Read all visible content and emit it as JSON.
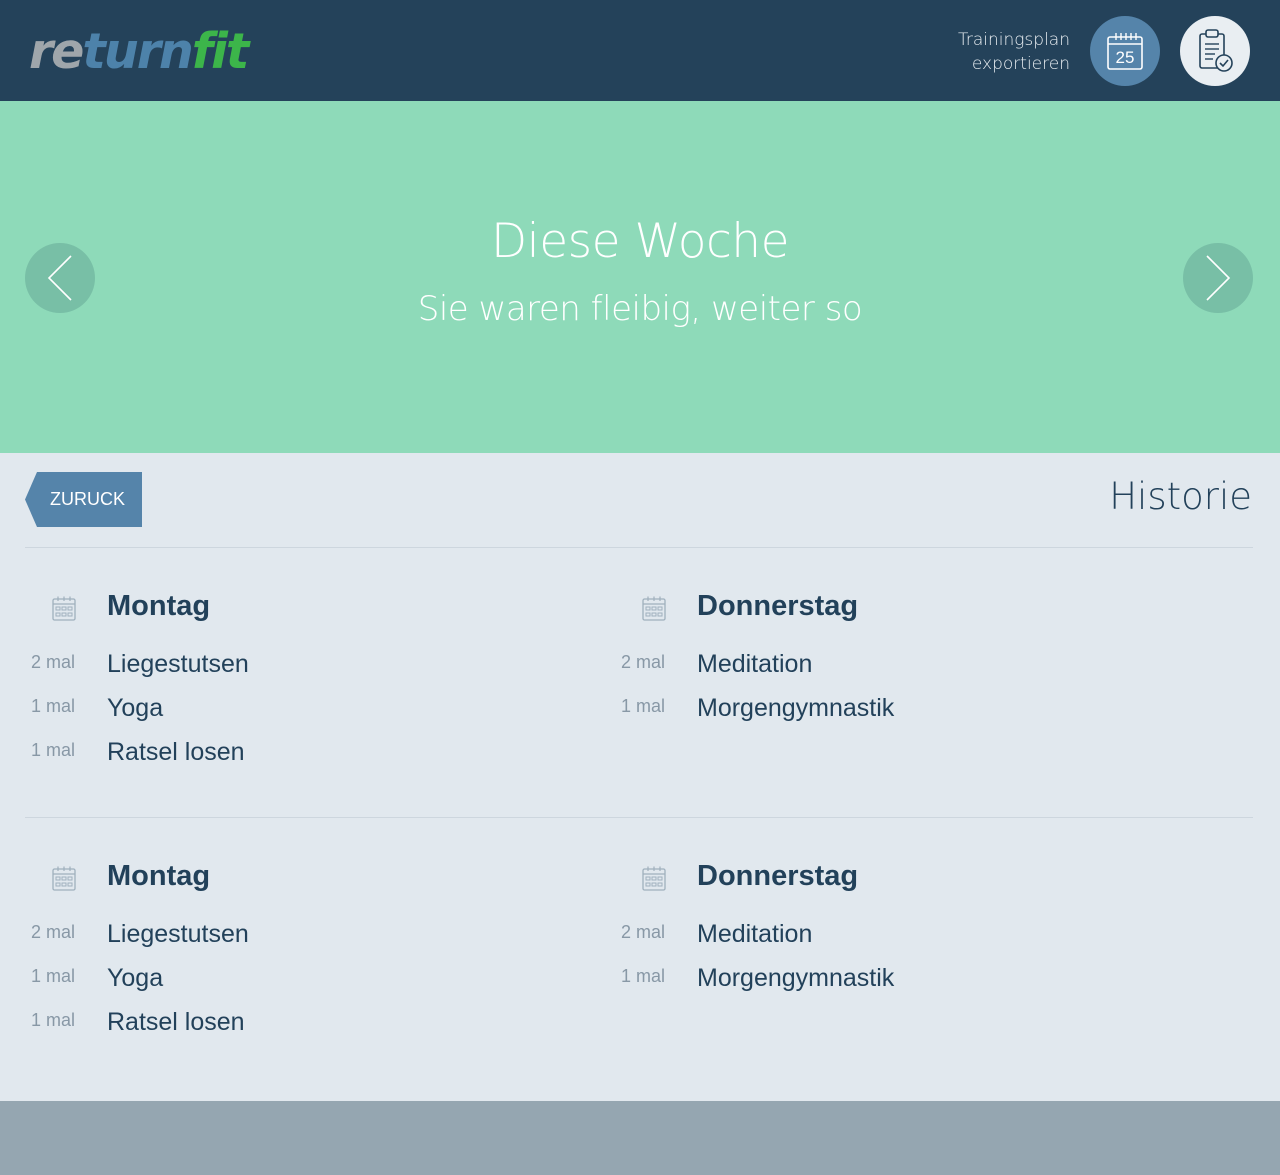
{
  "header": {
    "logo": {
      "part1": "re",
      "part2": "turn",
      "part3": "fit"
    },
    "export_label_line1": "Trainingsplan",
    "export_label_line2": "exportieren",
    "calendar_day": "25",
    "icons": {
      "export": "calendar-icon",
      "plan": "clipboard-check-icon"
    }
  },
  "hero": {
    "title": "Diese Woche",
    "subtitle": "Sie waren fleibig, weiter so",
    "prev": "chevron-left-icon",
    "next": "chevron-right-icon"
  },
  "history": {
    "back_label": "ZURUCK",
    "title": "Historie",
    "weeks": [
      {
        "days": [
          {
            "name": "Montag",
            "items": [
              {
                "count": "2 mal",
                "name": "Liegestutsen"
              },
              {
                "count": "1 mal",
                "name": "Yoga"
              },
              {
                "count": "1 mal",
                "name": "Ratsel losen"
              }
            ]
          },
          {
            "name": "Donnerstag",
            "items": [
              {
                "count": "2 mal",
                "name": "Meditation"
              },
              {
                "count": "1 mal",
                "name": "Morgengymnastik"
              }
            ]
          }
        ]
      },
      {
        "days": [
          {
            "name": "Montag",
            "items": [
              {
                "count": "2 mal",
                "name": "Liegestutsen"
              },
              {
                "count": "1 mal",
                "name": "Yoga"
              },
              {
                "count": "1 mal",
                "name": "Ratsel losen"
              }
            ]
          },
          {
            "name": "Donnerstag",
            "items": [
              {
                "count": "2 mal",
                "name": "Meditation"
              },
              {
                "count": "1 mal",
                "name": "Morgengymnastik"
              }
            ]
          }
        ]
      }
    ]
  },
  "colors": {
    "header_bg": "#24425a",
    "hero_bg": "#8edab9",
    "content_bg": "#e1e8ee",
    "accent": "#5584aa",
    "logo_green": "#3cb54a",
    "footer_bg": "#95a6b1"
  }
}
